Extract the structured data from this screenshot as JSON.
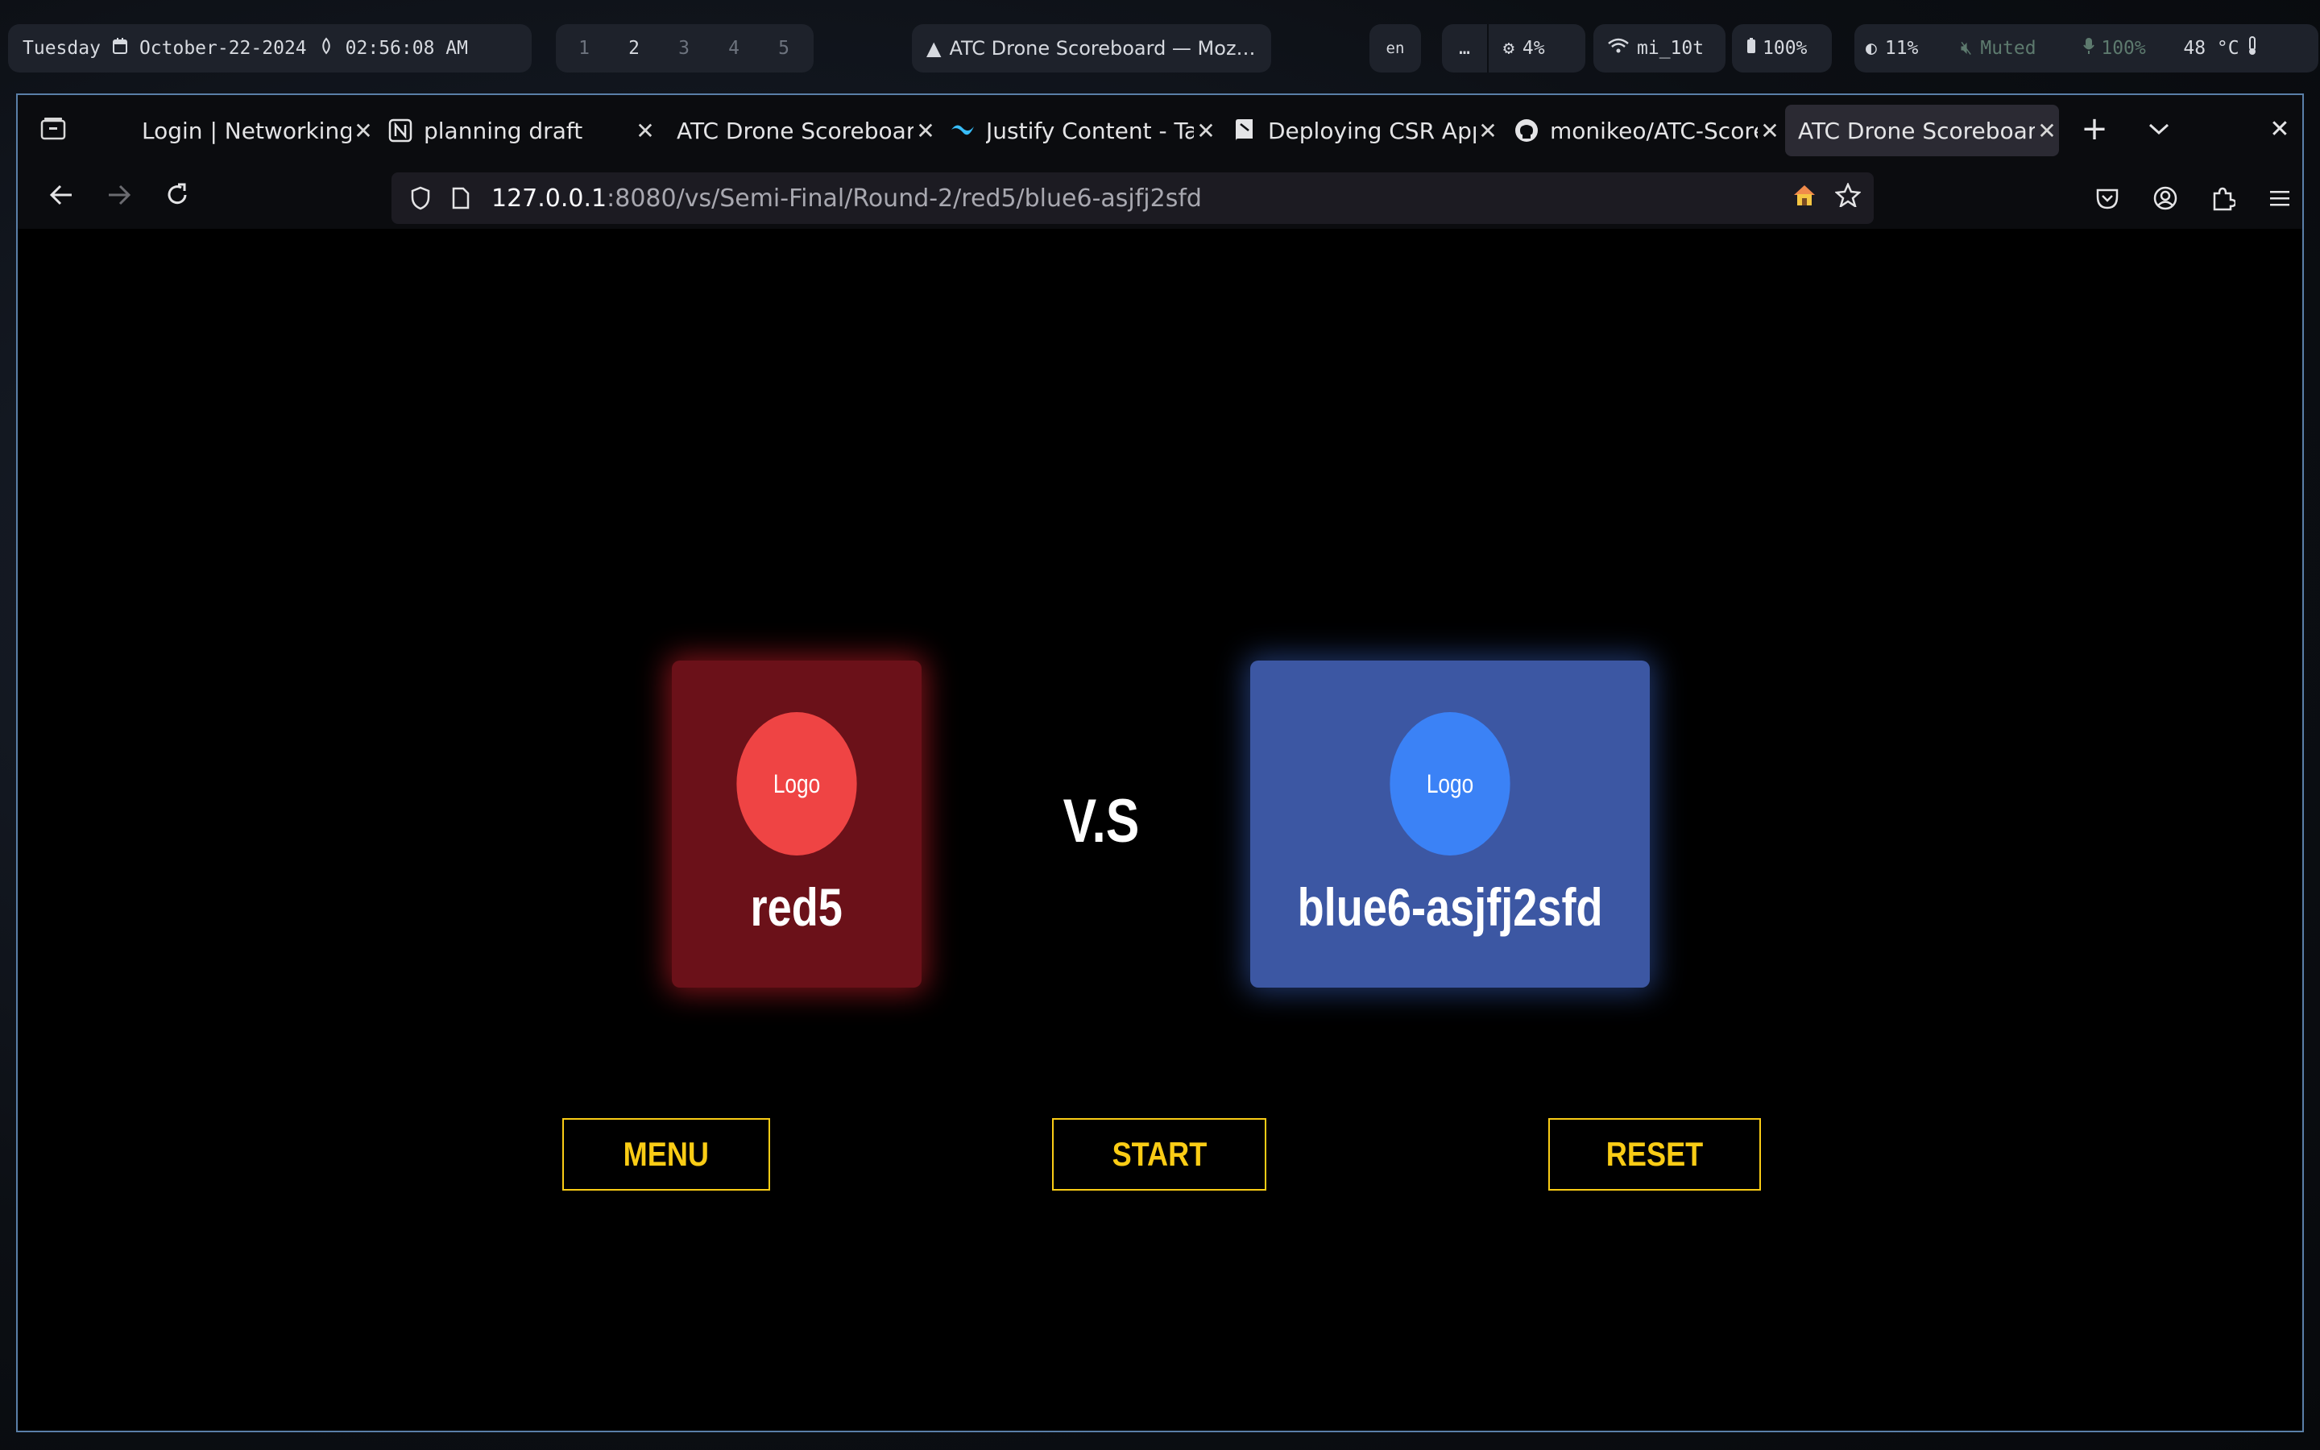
{
  "statusbar": {
    "day": "Tuesday",
    "date": "October-22-2024",
    "time": "02:56:08 AM",
    "workspaces": [
      "1",
      "2",
      "3",
      "4",
      "5"
    ],
    "active_workspace": "2",
    "window_title": "ATC Drone Scoreboard — Moz…",
    "lang": "en",
    "more": "…",
    "cpu": "4%",
    "wifi": "mi_10t",
    "battery": "100%",
    "brightness": "11%",
    "volume": "Muted",
    "mic": "100%",
    "temp": "48 °C"
  },
  "browser": {
    "tabs": [
      {
        "title": "Login | Networking",
        "icon": "none"
      },
      {
        "title": "planning draft",
        "icon": "notion-icon"
      },
      {
        "title": "ATC Drone Scoreboard",
        "icon": "none"
      },
      {
        "title": "Justify Content - Tailwind",
        "icon": "tailwind-icon"
      },
      {
        "title": "Deploying CSR Apps",
        "icon": "doc-icon"
      },
      {
        "title": "monikeo/ATC-Scoreboard",
        "icon": "github-icon"
      },
      {
        "title": "ATC Drone Scoreboard",
        "icon": "none",
        "active": true
      }
    ],
    "url_host": "127.0.0.1",
    "url_path": ":8080/vs/Semi-Final/Round-2/red5/blue6-asjfj2sfd"
  },
  "match": {
    "red": {
      "logo": "Logo",
      "name": "red5",
      "color": "#ef4444"
    },
    "blue": {
      "logo": "Logo",
      "name": "blue6-asjfj2sfd",
      "color": "#3b82f6"
    },
    "vs": "V.S"
  },
  "controls": {
    "menu": "MENU",
    "start": "START",
    "reset": "RESET",
    "accent": "#facc15"
  }
}
